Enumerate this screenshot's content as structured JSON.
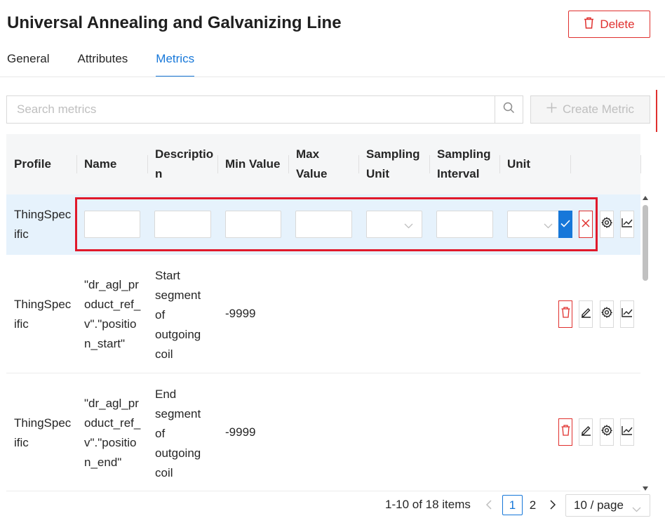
{
  "page": {
    "title": "Universal Annealing and Galvanizing Line",
    "delete_label": "Delete"
  },
  "tabs": [
    {
      "label": "General",
      "active": false
    },
    {
      "label": "Attributes",
      "active": false
    },
    {
      "label": "Metrics",
      "active": true
    }
  ],
  "toolbar": {
    "search_placeholder": "Search metrics",
    "search_value": "",
    "create_label": "Create Metric",
    "create_disabled": true
  },
  "table": {
    "columns": [
      "Profile",
      "Name",
      "Descriptio\nn",
      "Min Value",
      "Max\nValue",
      "Sampling\nUnit",
      "Sampling\nInterval",
      "Unit"
    ],
    "edit_row": {
      "profile": "ThingSpec\nific",
      "name": "",
      "description": "",
      "min_value": "",
      "max_value": "",
      "sampling_unit": "",
      "sampling_interval": "",
      "unit": ""
    },
    "rows": [
      {
        "profile": "ThingSpec\nific",
        "name": "\"dr_agl_pr\noduct_ref_\nv\".\"positio\nn_start\"",
        "description": "Start\nsegment\nof\noutgoing\ncoil",
        "min_value": "-9999",
        "max_value": "",
        "sampling_unit": "",
        "sampling_interval": "",
        "unit": ""
      },
      {
        "profile": "ThingSpec\nific",
        "name": "\"dr_agl_pr\noduct_ref_\nv\".\"positio\nn_end\"",
        "description": "End\nsegment\nof\noutgoing\ncoil",
        "min_value": "-9999",
        "max_value": "",
        "sampling_unit": "",
        "sampling_interval": "",
        "unit": ""
      }
    ]
  },
  "pagination": {
    "total_text": "1-10 of 18 items",
    "pages": [
      "1",
      "2"
    ],
    "current": "1",
    "page_size": "10 / page"
  },
  "colors": {
    "accent": "#1677d9",
    "danger": "#e0302e",
    "highlight": "#e0192b",
    "edit_row_bg": "#e6f2fc",
    "header_bg": "#f5f6f7"
  },
  "icons": {
    "delete": "trash-icon",
    "search": "search-icon",
    "create": "plus-icon",
    "confirm": "check-icon",
    "cancel": "close-icon",
    "settings": "gear-icon",
    "chart": "line-chart-icon",
    "edit": "pencil-icon",
    "dropdown": "chevron-down-icon"
  }
}
